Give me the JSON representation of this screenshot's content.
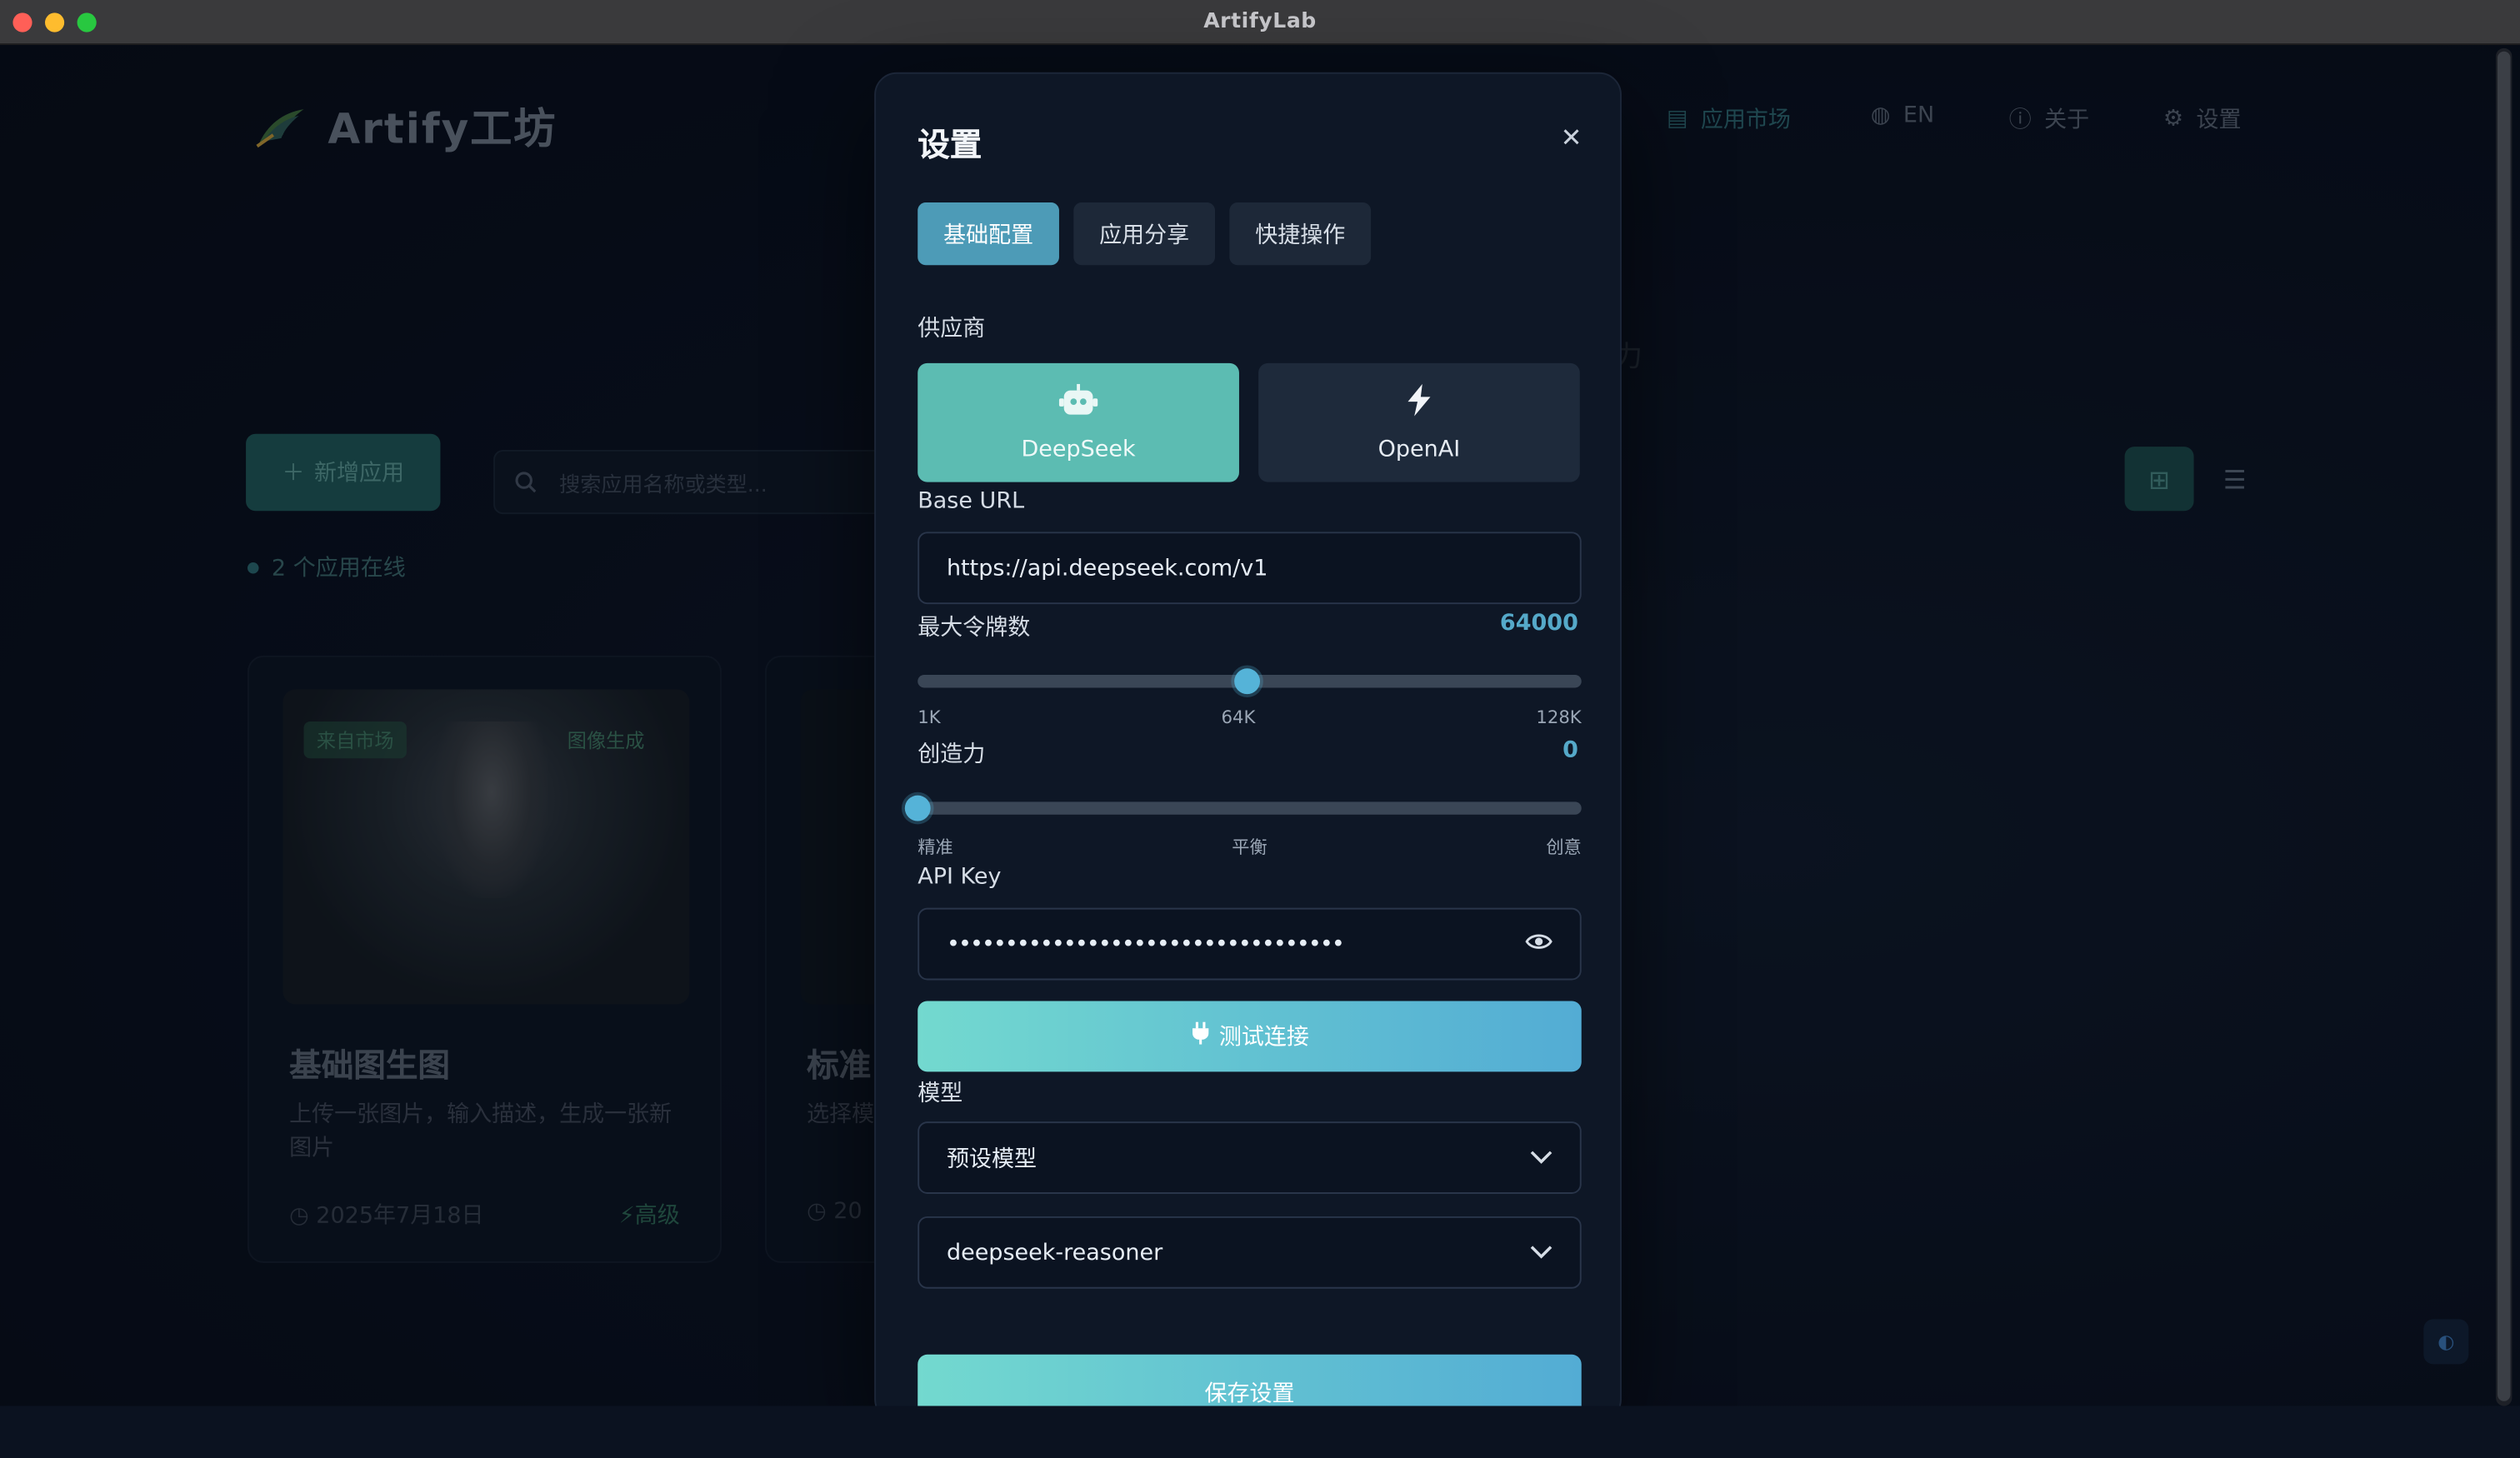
{
  "window": {
    "title": "ArtifyLab"
  },
  "background": {
    "logo_text": "Artify工坊",
    "nav": [
      {
        "label": "应用市场",
        "icon": "store-icon"
      },
      {
        "label": "EN",
        "icon": "globe-icon"
      },
      {
        "label": "关于",
        "icon": "info-icon"
      },
      {
        "label": "设置",
        "icon": "gear-icon"
      }
    ],
    "add_app_label": "新增应用",
    "search_placeholder": "搜索应用名称或类型...",
    "online_status": "2 个应用在线",
    "cards": [
      {
        "tag_source": "来自市场",
        "tag_type": "图像生成",
        "title": "基础图生图",
        "desc": "上传一张图片，输入描述，生成一张新图片",
        "date": "2025年7月18日",
        "level": "高级"
      },
      {
        "title": "标准",
        "desc": "选择模",
        "date": "20"
      }
    ]
  },
  "settings": {
    "title": "设置",
    "tabs": [
      "基础配置",
      "应用分享",
      "快捷操作"
    ],
    "active_tab": 0,
    "provider_label": "供应商",
    "providers": [
      {
        "name": "DeepSeek",
        "icon": "robot-icon",
        "active": true
      },
      {
        "name": "OpenAI",
        "icon": "bolt-icon",
        "active": false
      }
    ],
    "base_url_label": "Base URL",
    "base_url": "https://api.deepseek.com/v1",
    "max_tokens_label": "最大令牌数",
    "max_tokens_value": "64000",
    "max_tokens_fraction": 0.497,
    "max_tokens_ticks": [
      "1K",
      "64K",
      "128K"
    ],
    "creativity_label": "创造力",
    "creativity_value": "0",
    "creativity_fraction": 0.0,
    "creativity_ticks": [
      "精准",
      "平衡",
      "创意"
    ],
    "api_key_label": "API Key",
    "api_key_masked": "••••••••••••••••••••••••••••••••••",
    "test_button": "测试连接",
    "model_label": "模型",
    "model_preset": "预设模型",
    "model_selected": "deepseek-reasoner",
    "save_button": "保存设置"
  }
}
